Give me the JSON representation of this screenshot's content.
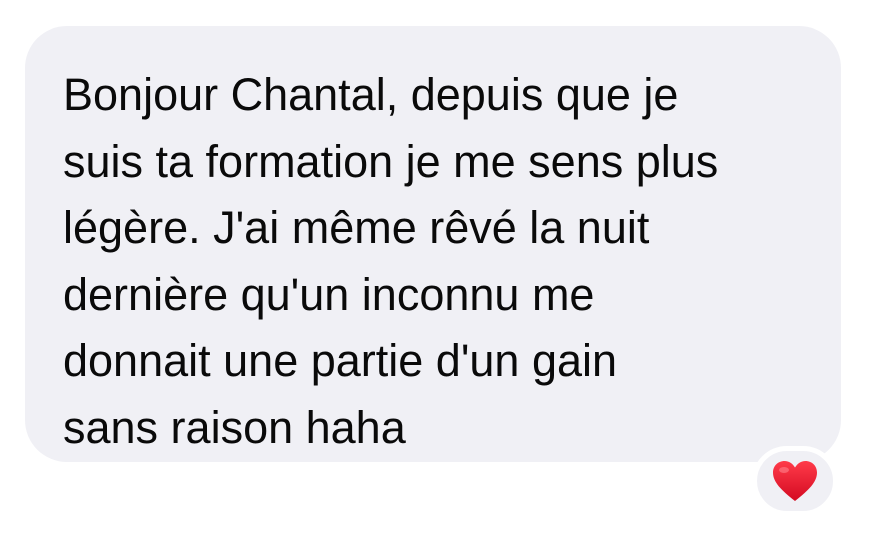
{
  "message": {
    "lines": [
      "Bonjour Chantal, depuis que je",
      "suis ta formation je me sens plus",
      "légère. J'ai même rêvé la nuit",
      "dernière qu'un inconnu me",
      "donnait une partie d'un gain",
      "sans raison haha"
    ],
    "bubble_color": "#f0f0f5",
    "text_color": "#0a0a0a"
  },
  "reaction": {
    "icon": "red-heart-icon",
    "color": "#e8132b"
  }
}
